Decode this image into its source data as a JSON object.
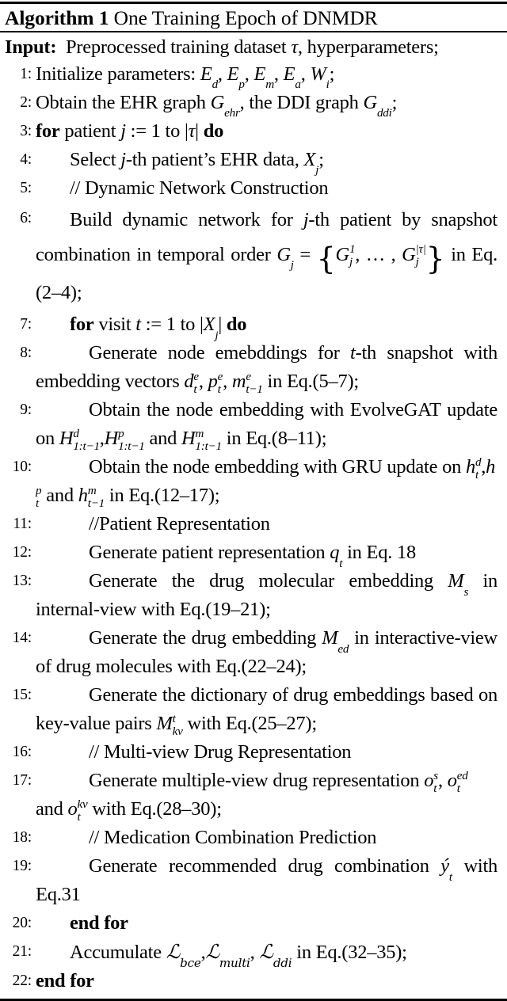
{
  "algorithm": {
    "label": "Algorithm 1",
    "title": "One Training Epoch of DNMDR",
    "input_label": "Input:",
    "input_text": "Preprocessed training dataset τ, hyperparameters;",
    "lines": [
      {
        "num": "1:",
        "level": 0,
        "text": "Initialize parameters: E_d, E_p, E_m, E_a, W_i;"
      },
      {
        "num": "2:",
        "level": 0,
        "text": "Obtain the EHR graph G_ehr, the DDI graph G_ddi;"
      },
      {
        "num": "3:",
        "level": 0,
        "text": "for patient j := 1 to |τ| do"
      },
      {
        "num": "4:",
        "level": 1,
        "text": "Select j-th patient's EHR data, X_j;"
      },
      {
        "num": "5:",
        "level": 1,
        "text": "// Dynamic Network Construction"
      },
      {
        "num": "6:",
        "level": 1,
        "text": "Build dynamic network for j-th patient by snapshot combination in temporal order G_j = { G_j^1, … , G_j^|τ| } in Eq.(2–4);"
      },
      {
        "num": "7:",
        "level": 1,
        "text": "for visit t := 1 to |X_j| do"
      },
      {
        "num": "8:",
        "level": 2,
        "text": "Generate node emebddings for t-th snapshot with embedding vectors d_t^e, p_t^e, m_{t-1}^e in Eq.(5–7);"
      },
      {
        "num": "9:",
        "level": 2,
        "text": "Obtain the node embedding with EvolveGAT update on H_{1:t-1}^d, H_{1:t-1}^p and H_{1:t-1}^m in Eq.(8–11);"
      },
      {
        "num": "10:",
        "level": 2,
        "text": "Obtain the node embedding with GRU update on h_t^d, h_t^p and h_{t-1}^m in Eq.(12–17);"
      },
      {
        "num": "11:",
        "level": 2,
        "text": "//Patient Representation"
      },
      {
        "num": "12:",
        "level": 2,
        "text": "Generate patient representation q_t in Eq. 18"
      },
      {
        "num": "13:",
        "level": 2,
        "text": "Generate the drug molecular embedding M_s in internal-view with Eq.(19–21);"
      },
      {
        "num": "14:",
        "level": 2,
        "text": "Generate the drug embedding M_ed in interactive-view of drug molecules with Eq.(22–24);"
      },
      {
        "num": "15:",
        "level": 2,
        "text": "Generate the dictionary of drug embeddings based on key-value pairs M_kv^t with Eq.(25–27);"
      },
      {
        "num": "16:",
        "level": 2,
        "text": "// Multi-view Drug Representation"
      },
      {
        "num": "17:",
        "level": 2,
        "text": "Generate multiple-view drug representation o_t^s, o_t^ed and o_t^kv with Eq.(28–30);"
      },
      {
        "num": "18:",
        "level": 2,
        "text": "// Medication Combination Prediction"
      },
      {
        "num": "19:",
        "level": 2,
        "text": "Generate recommended drug combination ŷ_t with Eq.31"
      },
      {
        "num": "20:",
        "level": 1,
        "text": "end for"
      },
      {
        "num": "21:",
        "level": 1,
        "text": "Accumulate L_bce, L_multi, L_ddi in Eq.(32–35);"
      },
      {
        "num": "22:",
        "level": 0,
        "text": "end for"
      }
    ]
  }
}
